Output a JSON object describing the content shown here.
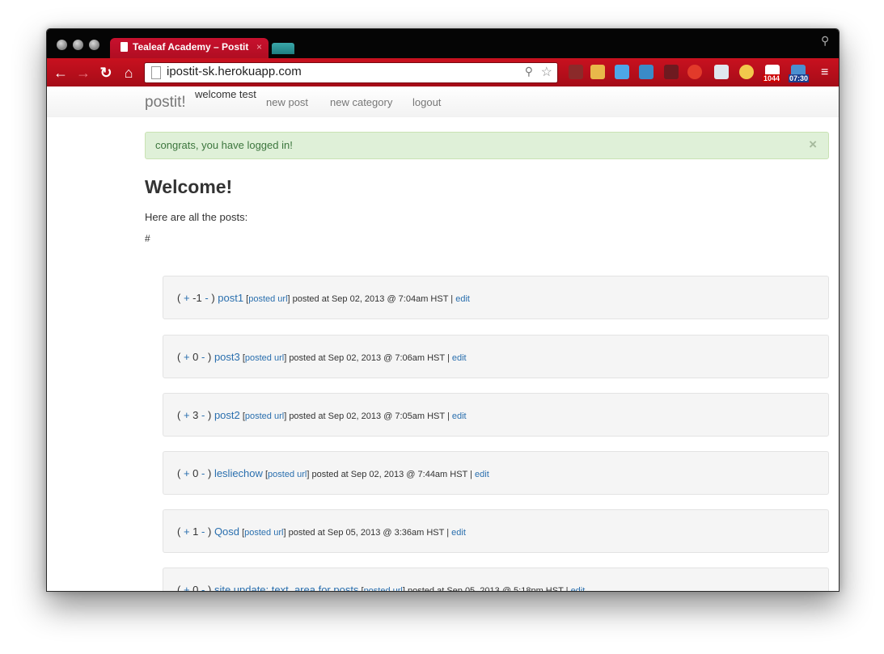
{
  "browser": {
    "tab_title": "Tealeaf Academy – Postit",
    "tab_close": "×",
    "url": "ipostit-sk.herokuapp.com",
    "extension_badges": {
      "mail": "1044",
      "clock": "07:30"
    }
  },
  "navbar": {
    "brand": "postit!",
    "welcome": "welcome test",
    "links": {
      "new_post": "new post",
      "new_category": "new category",
      "logout": "logout"
    }
  },
  "alert": {
    "message": "congrats, you have logged in!",
    "close": "×"
  },
  "main": {
    "heading": "Welcome!",
    "intro": "Here are all the posts:",
    "hash": "#"
  },
  "posts": [
    {
      "vote_up": "+",
      "votes": "-1",
      "vote_down": "-",
      "title": "post1",
      "url_label": "posted url",
      "meta": "posted at Sep 02, 2013 @ 7:04am HST |",
      "edit": "edit"
    },
    {
      "vote_up": "+",
      "votes": "0",
      "vote_down": "-",
      "title": "post3",
      "url_label": "posted url",
      "meta": "posted at Sep 02, 2013 @ 7:06am HST |",
      "edit": "edit"
    },
    {
      "vote_up": "+",
      "votes": "3",
      "vote_down": "-",
      "title": "post2",
      "url_label": "posted url",
      "meta": "posted at Sep 02, 2013 @ 7:05am HST |",
      "edit": "edit"
    },
    {
      "vote_up": "+",
      "votes": "0",
      "vote_down": "-",
      "title": "lesliechow",
      "url_label": "posted url",
      "meta": "posted at Sep 02, 2013 @ 7:44am HST |",
      "edit": "edit"
    },
    {
      "vote_up": "+",
      "votes": "1",
      "vote_down": "-",
      "title": "Qosd",
      "url_label": "posted url",
      "meta": "posted at Sep 05, 2013 @ 3:36am HST |",
      "edit": "edit"
    },
    {
      "vote_up": "+",
      "votes": "0",
      "vote_down": "-",
      "title": "site update: text_area for posts",
      "url_label": "posted url",
      "meta": "posted at Sep 05, 2013 @ 5:18pm HST |",
      "edit": "edit"
    }
  ],
  "colors": {
    "browser_accent": "#c9111f",
    "link": "#2a6fae",
    "alert_bg": "#dff0d8",
    "alert_text": "#3c763d"
  }
}
